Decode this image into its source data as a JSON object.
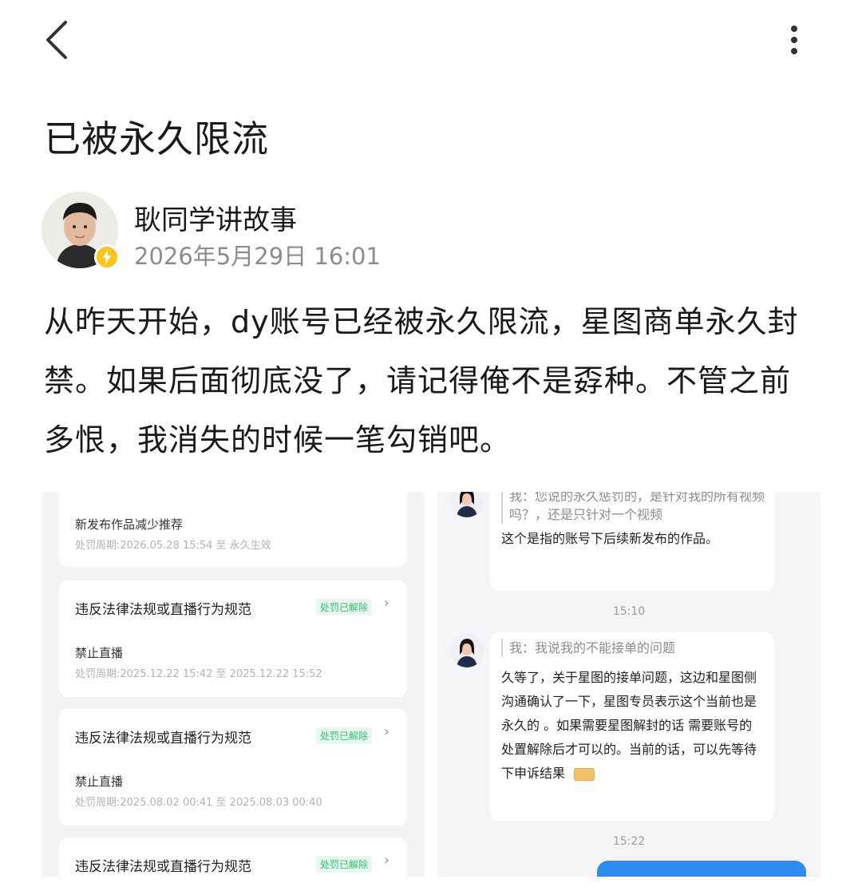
{
  "post": {
    "title": "已被永久限流",
    "author_name": "耿同学讲故事",
    "time": "2026年5月29日 16:01",
    "body": "从昨天开始，dy账号已经被永久限流，星图商单永久封禁。如果后面彻底没了，请记得俺不是孬种。不管之前多恨，我消失的时候一笔勾销吧。"
  },
  "penalty_list": {
    "items": [
      {
        "title": "",
        "status": "",
        "action": "新发布作品减少推荐",
        "period": "处罚周期:2026.05.28 15:54 至 永久生效"
      },
      {
        "title": "违反法律法规或直播行为规范",
        "status": "处罚已解除",
        "action": "禁止直播",
        "period": "处罚周期:2025.12.22 15:42 至 2025.12.22 15:52"
      },
      {
        "title": "违反法律法规或直播行为规范",
        "status": "处罚已解除",
        "action": "禁止直播",
        "period": "处罚周期:2025.08.02 00:41 至 2025.08.03 00:40"
      },
      {
        "title": "违反法律法规或直播行为规范",
        "status": "处罚已解除",
        "action": "",
        "period": ""
      }
    ],
    "chevron": "›"
  },
  "chat": {
    "messages": [
      {
        "quote": "我：您说的永久惩罚的，是针对我的所有视频吗？，还是只针对一个视频",
        "reply": "这个是指的账号下后续新发布的作品。"
      },
      {
        "quote": "我：我说我的不能接单的问题",
        "reply": "久等了，关于星图的接单问题，这边和星图侧沟通确认了一下，星图专员表示这个当前也是永久的 。如果需要星图解封的话 需要账号的处置解除后才可以的。当前的话，可以先等待下申诉结果"
      }
    ],
    "times": [
      "15:10",
      "15:22"
    ]
  },
  "colors": {
    "accent_badge": "#f7c51c",
    "status_green": "#2fbf71",
    "send_blue": "#2d8cf0"
  },
  "icons": [
    "back-arrow-icon",
    "more-vertical-icon",
    "verified-badge-icon",
    "chevron-right-icon",
    "emoji-icon"
  ]
}
